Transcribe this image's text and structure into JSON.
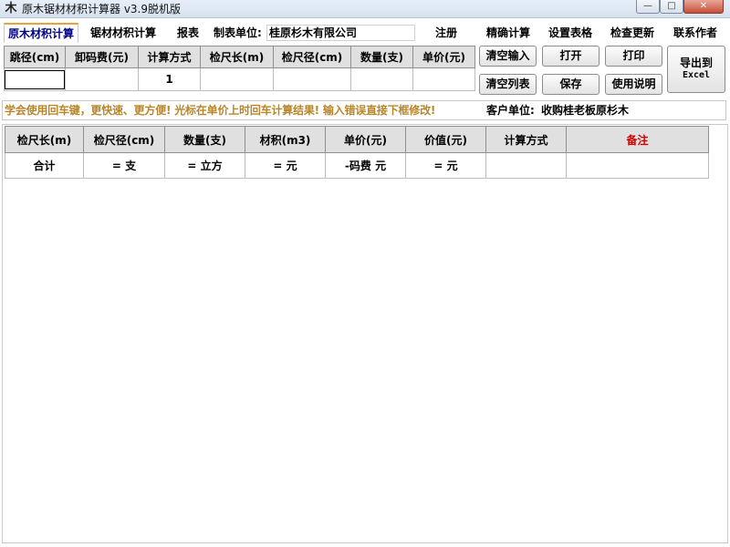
{
  "window": {
    "title": "原木锯材材积计算器 v3.9脱机版",
    "app_icon_glyph": "木",
    "minimize_glyph": "—",
    "maximize_glyph": "□",
    "close_glyph": "✕"
  },
  "tabs": [
    {
      "label": "原木材积计算",
      "active": true
    },
    {
      "label": "锯材材积计算",
      "active": false
    },
    {
      "label": "报表",
      "active": false
    }
  ],
  "maker": {
    "label": "制表单位:",
    "value": "桂原杉木有限公司"
  },
  "menu": {
    "register": "注册",
    "precise": "精确计算",
    "settings": "设置表格",
    "update": "检查更新",
    "contact": "联系作者"
  },
  "input_grid": {
    "headers": [
      "跳径(cm)",
      "卸码费(元)",
      "计算方式",
      "检尺长(m)",
      "检尺径(cm)",
      "数量(支)",
      "单价(元)"
    ],
    "row": [
      "",
      "",
      "1",
      "",
      "",
      "",
      ""
    ]
  },
  "buttons": {
    "clear_input": "清空输入",
    "open": "打开",
    "print": "打印",
    "clear_list": "清空列表",
    "save": "保存",
    "help": "使用说明",
    "export_line1": "导出到",
    "export_line2": "Excel"
  },
  "hint": {
    "text": "学会使用回车键，更快速、更方便! 光标在单价上时回车计算结果! 输入错误直接下框修改!",
    "customer_label": "客户单位:",
    "customer_value": "收购桂老板原杉木"
  },
  "results": {
    "headers": [
      "检尺长(m)",
      "检尺径(cm)",
      "数量(支)",
      "材积(m3)",
      "单价(元)",
      "价值(元)",
      "计算方式",
      "备注"
    ],
    "total_row": [
      "合计",
      "= 支",
      "= 立方",
      "= 元",
      "-码费 元",
      "= 元",
      "",
      ""
    ]
  },
  "colors": {
    "active_tab_text": "#00008b",
    "hint_text": "#b8862b",
    "remark_header": "#d00000"
  }
}
